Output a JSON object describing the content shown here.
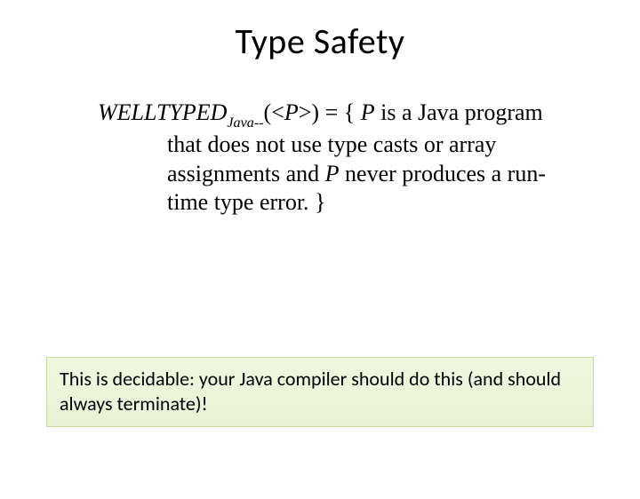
{
  "title": "Type Safety",
  "definition": {
    "funcName": "WELLTYPED",
    "subscript": "Java--",
    "argOpen": "(<",
    "argVar": "P",
    "argClose": ">) = { ",
    "var2": "P",
    "afterVar2": " is a Java program that does not use type casts or array assignments and ",
    "var3": "P",
    "afterVar3": " never produces a run-time type error. }"
  },
  "callout": "This is decidable: your Java compiler should do this (and should always terminate)!"
}
